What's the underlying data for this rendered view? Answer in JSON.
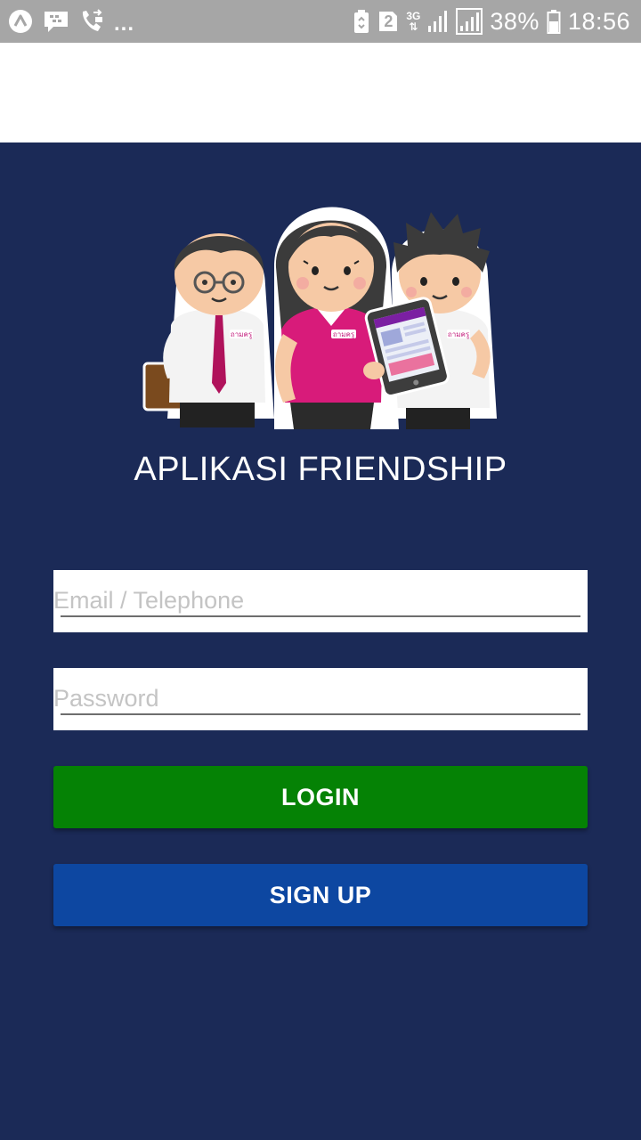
{
  "status_bar": {
    "notification_icons": [
      "android-wear-icon",
      "bbm-chat-icon",
      "call-forwarding-icon"
    ],
    "more_notifications": "...",
    "sim_slot": "2",
    "network_type": "3G",
    "battery_percent": "38%",
    "time": "18:56"
  },
  "app": {
    "title": "APLIKASI FRIENDSHIP",
    "badge_text": "ถามครู"
  },
  "login_form": {
    "email_placeholder": "Email / Telephone",
    "password_placeholder": "Password",
    "login_label": "LOGIN",
    "signup_label": "SIGN UP"
  },
  "colors": {
    "background": "#1b2a57",
    "login_button": "#058205",
    "signup_button": "#0d47a1",
    "status_bar": "#a6a6a6"
  }
}
